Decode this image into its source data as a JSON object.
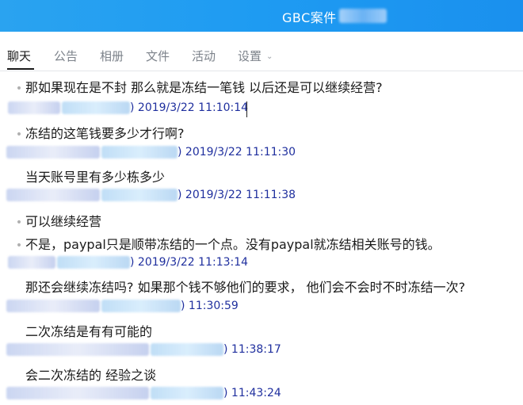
{
  "window": {
    "title": "GBC案件"
  },
  "tabs": [
    {
      "label": "聊天",
      "active": true
    },
    {
      "label": "公告",
      "active": false
    },
    {
      "label": "相册",
      "active": false
    },
    {
      "label": "文件",
      "active": false
    },
    {
      "label": "活动",
      "active": false
    },
    {
      "label": "设置",
      "active": false,
      "dropdown": true
    }
  ],
  "colors": {
    "titlebar": "#1e9bf2",
    "meta_text": "#1f2f9e",
    "accent": "#1a1a1a"
  },
  "chat": [
    {
      "type": "message",
      "bullet": true,
      "text": "那如果现在是不封 那么就是冻结一笔钱 以后还是可以继续经营?"
    },
    {
      "type": "meta",
      "paren": ")",
      "time": "2019/3/22 11:10:14"
    },
    {
      "type": "message",
      "bullet": true,
      "text": "冻结的这笔钱要多少才行啊?"
    },
    {
      "type": "meta",
      "paren": ")",
      "time": "2019/3/22 11:11:30"
    },
    {
      "type": "message",
      "bullet": false,
      "text": "当天账号里有多少栋多少"
    },
    {
      "type": "meta",
      "paren": ")",
      "time": "2019/3/22 11:11:38"
    },
    {
      "type": "message",
      "bullet": true,
      "text": "可以继续经营"
    },
    {
      "type": "message",
      "bullet": true,
      "text": "不是，paypal只是顺带冻结的一个点。没有paypal就冻结相关账号的钱。"
    },
    {
      "type": "meta",
      "paren": ")",
      "time": "2019/3/22 11:13:14"
    },
    {
      "type": "message",
      "bullet": false,
      "text": "那还会继续冻结吗? 如果那个钱不够他们的要求， 他们会不会时不时冻结一次?"
    },
    {
      "type": "meta",
      "paren": ")",
      "time": "11:30:59"
    },
    {
      "type": "message",
      "bullet": false,
      "text": "二次冻结是有有可能的"
    },
    {
      "type": "meta",
      "paren": ")",
      "time": "11:38:17"
    },
    {
      "type": "message",
      "bullet": false,
      "text": "会二次冻结的 经验之谈"
    },
    {
      "type": "meta",
      "paren": ")",
      "time": "11:43:24"
    }
  ]
}
